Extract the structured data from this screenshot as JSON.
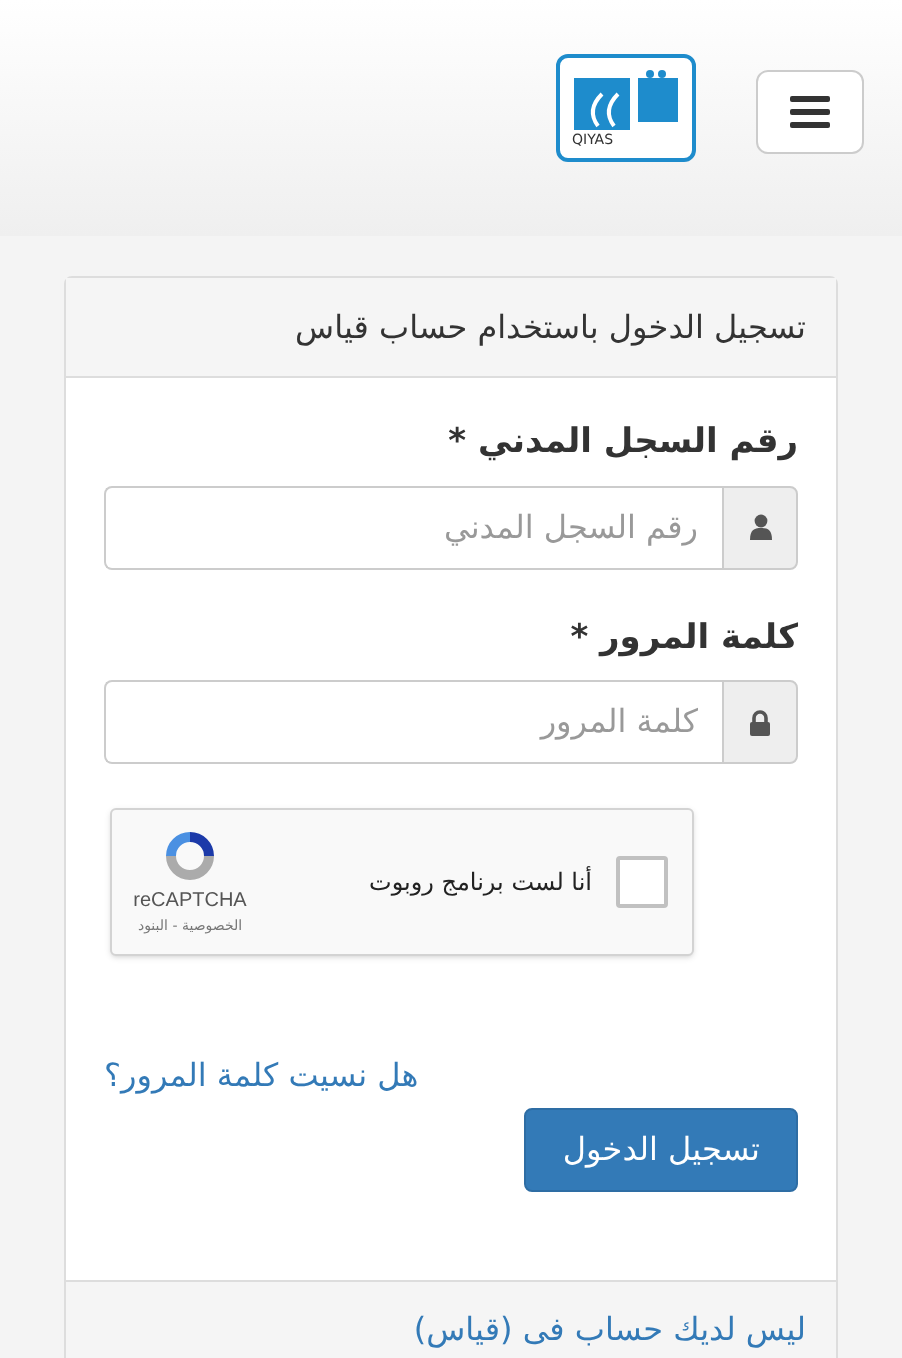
{
  "header": {
    "logo_text": "QIYAS",
    "menu_expanded": false
  },
  "card": {
    "title": "تسجيل الدخول باستخدام حساب قياس",
    "fields": [
      {
        "label": "رقم السجل المدني *",
        "placeholder": "رقم السجل المدني",
        "kind": "user"
      },
      {
        "label": "كلمة المرور *",
        "placeholder": "كلمة المرور",
        "kind": "lock"
      }
    ],
    "captcha": {
      "label": "أنا لست برنامج روبوت",
      "checked": false,
      "brand": "reCAPTCHA",
      "links": "الخصوصية - البنود"
    },
    "forgot_link": "هل نسيت كلمة المرور؟",
    "submit": "تسجيل الدخول",
    "footer_link": "ليس لديك حساب فى (قياس)"
  }
}
